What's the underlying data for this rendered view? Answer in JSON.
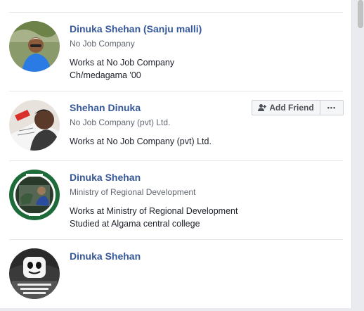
{
  "results": [
    {
      "name": "Dinuka Shehan (Sanju malli)",
      "subtitle": "No Job Company",
      "details": [
        "Works at No Job Company",
        "Ch/medagama '00"
      ]
    },
    {
      "name": "Shehan Dinuka",
      "subtitle": "No Job Company (pvt) Ltd.",
      "details": [
        "Works at No Job Company (pvt) Ltd."
      ],
      "add_friend_label": "Add Friend",
      "more_label": "•••"
    },
    {
      "name": "Dinuka Shehan",
      "subtitle": "Ministry of Regional Development",
      "details": [
        "Works at Ministry of Regional Development",
        "Studied at Algama central college"
      ]
    },
    {
      "name": "Dinuka Shehan"
    }
  ],
  "colors": {
    "name_link": "#365899",
    "subtitle": "#616770",
    "detail_text": "#1d2129",
    "page_bg": "#e9ebee"
  }
}
